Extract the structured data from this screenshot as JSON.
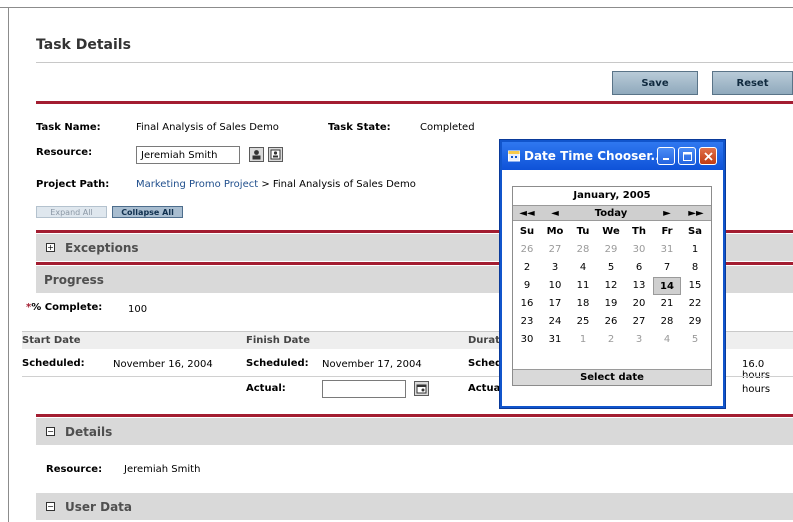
{
  "page": {
    "title": "Task Details"
  },
  "toolbar": {
    "save_label": "Save",
    "reset_label": "Reset"
  },
  "task": {
    "name_label": "Task Name:",
    "name_value": "Final Analysis of Sales Demo",
    "state_label": "Task State:",
    "state_value": "Completed",
    "resource_label": "Resource:",
    "resource_value": "Jeremiah Smith",
    "project_path_label": "Project Path:",
    "project_link": "Marketing Promo Project",
    "project_tail": " > Final Analysis of Sales Demo",
    "expand_all": "Expand All",
    "collapse_all": "Collapse All"
  },
  "sections": {
    "exceptions": "Exceptions",
    "progress": "Progress",
    "details": "Details",
    "user_data": "User Data"
  },
  "progress": {
    "complete_label": "% Complete:",
    "complete_prefix": "*",
    "complete_value": "100",
    "headers": {
      "start": "Start Date",
      "finish": "Finish Date",
      "duration": "Durat"
    },
    "scheduled_label": "Scheduled:",
    "start_scheduled": "November 16, 2004",
    "finish_scheduled": "November 17, 2004",
    "duration_scheduled_label": "Sched",
    "actual_label": "Actual:",
    "duration_actual_label": "Actua",
    "effort_scheduled": "16.0  hours",
    "effort_actual": "hours"
  },
  "details": {
    "resource_label": "Resource:",
    "resource_value": "Jeremiah Smith"
  },
  "popup": {
    "title": "Date Time Chooser...",
    "month": "January, 2005",
    "nav": {
      "prev_year": "◄◄",
      "prev_month": "◄",
      "today": "Today",
      "next_month": "►",
      "next_year": "►►"
    },
    "days_of_week": [
      "Su",
      "Mo",
      "Tu",
      "We",
      "Th",
      "Fr",
      "Sa"
    ],
    "weeks": [
      [
        "26",
        "27",
        "28",
        "29",
        "30",
        "31",
        "1"
      ],
      [
        "2",
        "3",
        "4",
        "5",
        "6",
        "7",
        "8"
      ],
      [
        "9",
        "10",
        "11",
        "12",
        "13",
        "14",
        "15"
      ],
      [
        "16",
        "17",
        "18",
        "19",
        "20",
        "21",
        "22"
      ],
      [
        "23",
        "24",
        "25",
        "26",
        "27",
        "28",
        "29"
      ],
      [
        "30",
        "31",
        "1",
        "2",
        "3",
        "4",
        "5"
      ]
    ],
    "select_label": "Select date"
  },
  "colors": {
    "accent_red": "#a31d31",
    "button_blue": "#8fa9bc",
    "popup_title": "#1155cc"
  }
}
